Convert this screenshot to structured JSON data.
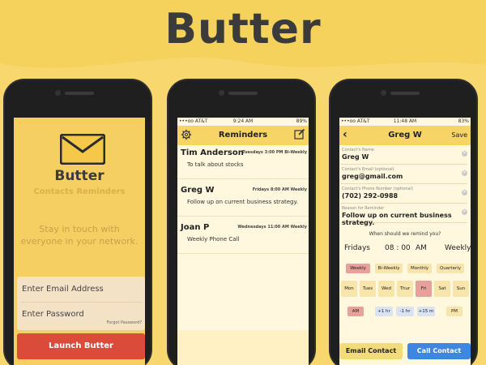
{
  "brand": {
    "title": "Butter"
  },
  "screen1": {
    "app_name": "Butter",
    "app_subtitle": "Contacts Reminders",
    "tagline": "Stay in touch with everyone in your network.",
    "email_placeholder": "Enter Email Address",
    "password_placeholder": "Enter Password",
    "forgot_password": "Forgot Password?",
    "launch_button": "Launch Butter"
  },
  "screen2": {
    "status": {
      "carrier": "•••oo AT&T",
      "time": "9:24 AM",
      "battery": "89%"
    },
    "title": "Reminders",
    "items": [
      {
        "name": "Tim Anderson",
        "when": "Tuesdays 3:00 PM Bi-Weekly",
        "note": "To talk about stocks"
      },
      {
        "name": "Greg W",
        "when": "Fridays 8:00 AM Weekly",
        "note": "Follow up on current business strategy."
      },
      {
        "name": "Joan P",
        "when": "Wednesdays 11:00 AM Weekly",
        "note": "Weekly Phone Call"
      }
    ]
  },
  "screen3": {
    "status": {
      "carrier": "•••oo AT&T",
      "time": "11:48 AM",
      "battery": "83%"
    },
    "title": "Greg W",
    "save_label": "Save",
    "fields": [
      {
        "label": "Contact's Name",
        "value": "Greg W"
      },
      {
        "label": "Contact's Email (optional)",
        "value": "greg@gmail.com"
      },
      {
        "label": "Contact's Phone Number (optional)",
        "value": "(702) 292-0988"
      },
      {
        "label": "Reason for Reminder",
        "value": "Follow up on current business strategy."
      }
    ],
    "question": "When should we remind you?",
    "summary": {
      "day": "Fridays",
      "time": "08 : 00",
      "ampm": "AM",
      "frequency": "Weekly"
    },
    "frequencies": [
      "Weekly",
      "Bi-Weekly",
      "Monthly",
      "Quarterly"
    ],
    "selected_frequency": "Weekly",
    "days": [
      "Mon",
      "Tues",
      "Wed",
      "Thur",
      "Fri",
      "Sat",
      "Sun"
    ],
    "selected_day": "Fri",
    "time_buttons": {
      "am": "AM",
      "plus_hour": "+1 hr",
      "minus_hour": "-1 hr",
      "plus_15": "+15 m",
      "pm": "PM"
    },
    "email_button": "Email Contact",
    "call_button": "Call Contact"
  },
  "colors": {
    "accent": "#F6D466",
    "launch": "#DB4B3A",
    "call": "#3F86E3",
    "selected": "#E8A09A"
  }
}
